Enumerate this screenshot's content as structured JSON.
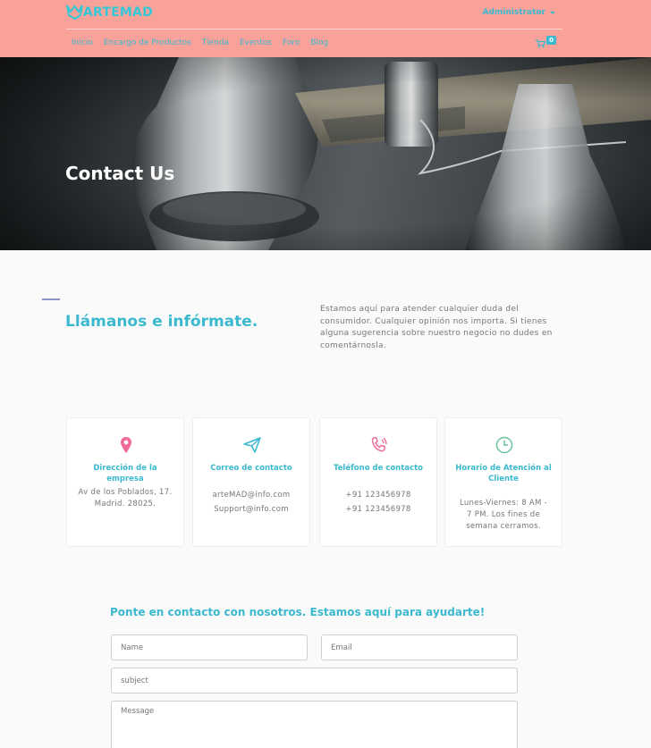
{
  "brand": {
    "name": "ARTEMAD"
  },
  "user_menu": {
    "label": "Administrator"
  },
  "nav": {
    "items": [
      "Inicio",
      "Encargo de Productos",
      "Tienda",
      "Eventos",
      "Foro",
      "Blog"
    ]
  },
  "cart": {
    "count": "0"
  },
  "hero": {
    "title": "Contact Us"
  },
  "intro": {
    "heading": "Llámanos e infórmate.",
    "text": "Estamos aquí para atender cualquier duda del consumidor. Cualquier opinión nos importa. Si tienes alguna sugerencia sobre nuestro negocio no dudes en comentárnosla."
  },
  "cards": [
    {
      "icon": "map-pin-icon",
      "title": "Dirección de la empresa",
      "lines": [
        "Av de los Poblados, 17.",
        "Madrid. 28025."
      ]
    },
    {
      "icon": "paper-plane-icon",
      "title": "Correo de contacto",
      "lines": [
        "arteMAD@info.com",
        "Support@info.com"
      ]
    },
    {
      "icon": "phone-ringing-icon",
      "title": "Teléfono de contacto",
      "lines": [
        "+91 123456978",
        "+91 123456978"
      ]
    },
    {
      "icon": "clock-icon",
      "title": "Horario de Atención al Cliente",
      "lines": [
        "Lunes-Viernes: 8 AM -",
        "7 PM. Los fines de",
        "semana cerramos."
      ]
    }
  ],
  "form": {
    "heading": "Ponte en contacto con nosotros. Estamos aquí para ayudarte!",
    "name_placeholder": "Name",
    "email_placeholder": "Email",
    "subject_placeholder": "subject",
    "message_placeholder": "Message"
  },
  "colors": {
    "header_bg": "#f9a29a",
    "accent": "#3ab9cf",
    "icon_pink": "#f06b9a",
    "icon_teal": "#3ab9cf",
    "icon_green": "#68c39a"
  }
}
